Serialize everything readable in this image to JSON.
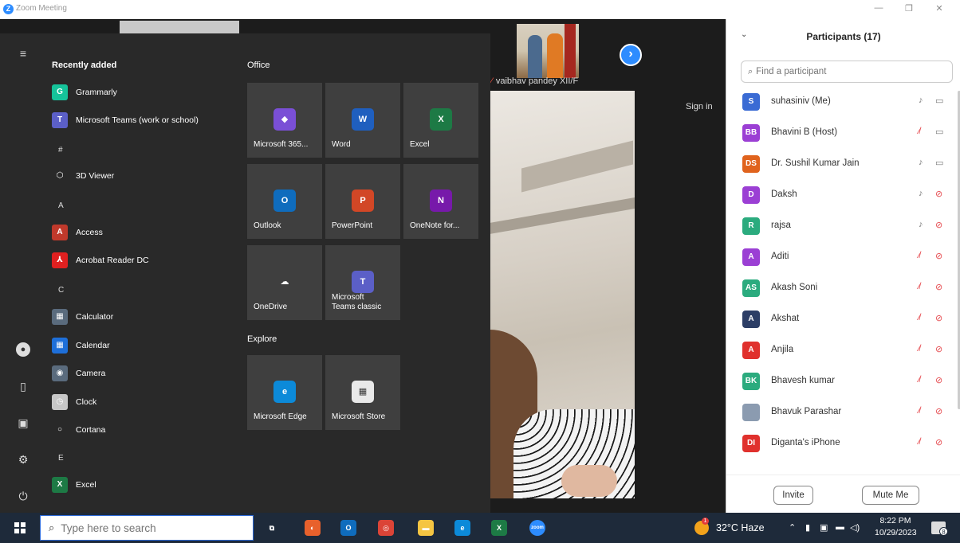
{
  "window": {
    "title": "Zoom Meeting",
    "logo_letter": "Z"
  },
  "meeting": {
    "thumbnail_name": "vaibhav pandey XII/F",
    "signin_label": "Sign in"
  },
  "start_menu": {
    "recently_added_heading": "Recently added",
    "apps": [
      {
        "label": "Grammarly",
        "icon": "grammarly-icon",
        "glyph": "G",
        "color": "#15c39a"
      },
      {
        "label": "Microsoft Teams (work or school)",
        "icon": "teams-icon",
        "glyph": "T",
        "color": "#5b5fc7"
      },
      {
        "label": "3D Viewer",
        "icon": "cube-icon",
        "glyph": "⬡",
        "color": "transparent"
      },
      {
        "label": "Access",
        "icon": "access-icon",
        "glyph": "A",
        "color": "#c0392b"
      },
      {
        "label": "Acrobat Reader DC",
        "icon": "acrobat-icon",
        "glyph": "⅄",
        "color": "#e02020"
      },
      {
        "label": "Calculator",
        "icon": "calculator-icon",
        "glyph": "▦",
        "color": "#5a6b7d"
      },
      {
        "label": "Calendar",
        "icon": "calendar-icon",
        "glyph": "▦",
        "color": "#1e6fd9"
      },
      {
        "label": "Camera",
        "icon": "camera-icon",
        "glyph": "◉",
        "color": "#5a6b7d"
      },
      {
        "label": "Clock",
        "icon": "clock-icon",
        "glyph": "◷",
        "color": "#c7c7c7"
      },
      {
        "label": "Cortana",
        "icon": "cortana-icon",
        "glyph": "○",
        "color": "transparent"
      },
      {
        "label": "Excel",
        "icon": "excel-icon",
        "glyph": "X",
        "color": "#1d7a45"
      }
    ],
    "letters": [
      "#",
      "A",
      "C",
      "E"
    ],
    "office_heading": "Office",
    "office_tiles": [
      {
        "label": "Microsoft 365...",
        "icon": "microsoft-365-icon",
        "glyph": "◆",
        "color": "#7a4fd6"
      },
      {
        "label": "Word",
        "icon": "word-icon",
        "glyph": "W",
        "color": "#1f5fbf"
      },
      {
        "label": "Excel",
        "icon": "excel-icon",
        "glyph": "X",
        "color": "#1d7a45"
      },
      {
        "label": "Outlook",
        "icon": "outlook-icon",
        "glyph": "O",
        "color": "#0f6cbd"
      },
      {
        "label": "PowerPoint",
        "icon": "powerpoint-icon",
        "glyph": "P",
        "color": "#d24726"
      },
      {
        "label": "OneNote for...",
        "icon": "onenote-icon",
        "glyph": "N",
        "color": "#7719aa"
      },
      {
        "label": "OneDrive",
        "icon": "onedrive-icon",
        "glyph": "☁",
        "color": "transparent"
      },
      {
        "label": "Microsoft Teams classic",
        "icon": "teams-classic-icon",
        "glyph": "T",
        "color": "#5b5fc7"
      }
    ],
    "explore_heading": "Explore",
    "explore_tiles": [
      {
        "label": "Microsoft Edge",
        "icon": "edge-icon",
        "glyph": "e",
        "color": "#0c8ad9"
      },
      {
        "label": "Microsoft Store",
        "icon": "store-icon",
        "glyph": "▦",
        "color": "#e9e9e9"
      }
    ]
  },
  "participants_panel": {
    "title": "Participants (17)",
    "search_placeholder": "Find a participant",
    "participants": [
      {
        "initials": "S",
        "name": "suhasiniv (Me)",
        "color": "#3a6bd4",
        "mic_muted": false,
        "video_off": false
      },
      {
        "initials": "BB",
        "name": "Bhavini B (Host)",
        "color": "#9b3fd4",
        "mic_muted": true,
        "video_off": false
      },
      {
        "initials": "DS",
        "name": "Dr. Sushil Kumar Jain",
        "color": "#e0631d",
        "mic_muted": false,
        "video_off": false
      },
      {
        "initials": "D",
        "name": "Daksh",
        "color": "#9b3fd4",
        "mic_muted": false,
        "video_off": true
      },
      {
        "initials": "R",
        "name": "rajsa",
        "color": "#2bab7e",
        "mic_muted": false,
        "video_off": true
      },
      {
        "initials": "A",
        "name": "Aditi",
        "color": "#9b3fd4",
        "mic_muted": true,
        "video_off": true
      },
      {
        "initials": "AS",
        "name": "Akash Soni",
        "color": "#2bab7e",
        "mic_muted": true,
        "video_off": true
      },
      {
        "initials": "A",
        "name": "Akshat",
        "color": "#2c3e66",
        "mic_muted": true,
        "video_off": true
      },
      {
        "initials": "A",
        "name": "Anjila",
        "color": "#e0312d",
        "mic_muted": true,
        "video_off": true
      },
      {
        "initials": "BK",
        "name": "Bhavesh kumar",
        "color": "#2bab7e",
        "mic_muted": true,
        "video_off": true
      },
      {
        "initials": "",
        "name": "Bhavuk Parashar",
        "color": "#8b9bb0",
        "mic_muted": true,
        "video_off": true
      },
      {
        "initials": "DI",
        "name": "Diganta's iPhone",
        "color": "#e0312d",
        "mic_muted": true,
        "video_off": true
      }
    ],
    "invite_label": "Invite",
    "mute_label": "Mute Me"
  },
  "taskbar": {
    "search_placeholder": "Type here to search",
    "weather": "32°C  Haze",
    "weather_badge": "1",
    "time": "8:22 PM",
    "date": "10/29/2023",
    "notification_count": "8",
    "pinned_apps": [
      {
        "icon": "task-view-icon",
        "glyph": "⧉",
        "color": "transparent"
      },
      {
        "icon": "firefox-icon",
        "glyph": "◐",
        "color": "#e8612c"
      },
      {
        "icon": "outlook-icon",
        "glyph": "O",
        "color": "#0f6cbd"
      },
      {
        "icon": "chrome-icon",
        "glyph": "◎",
        "color": "#db4437"
      },
      {
        "icon": "file-explorer-icon",
        "glyph": "▬",
        "color": "#f5c542"
      },
      {
        "icon": "edge-icon",
        "glyph": "e",
        "color": "#0c8ad9"
      },
      {
        "icon": "excel-icon",
        "glyph": "X",
        "color": "#1d7a45"
      },
      {
        "icon": "zoom-icon",
        "glyph": "zoom",
        "color": "#2d8cff"
      }
    ]
  }
}
